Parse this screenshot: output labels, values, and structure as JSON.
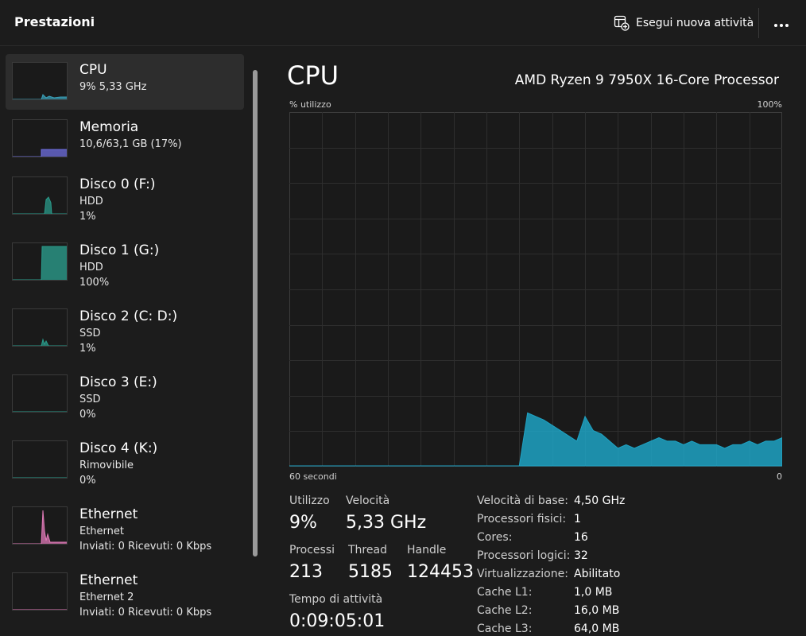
{
  "header": {
    "title": "Prestazioni",
    "run_task_label": "Esegui nuova attività",
    "more_icon": "ellipsis-icon"
  },
  "sidebar": {
    "items": [
      {
        "name": "CPU",
        "line1": "9%  5,33 GHz",
        "line2": "",
        "color": "#3aa0b8",
        "selected": true
      },
      {
        "name": "Memoria",
        "line1": "10,6/63,1 GB (17%)",
        "line2": "",
        "color": "#6f6fe0"
      },
      {
        "name": "Disco 0 (F:)",
        "line1": "HDD",
        "line2": "1%",
        "color": "#2a9a8a"
      },
      {
        "name": "Disco 1 (G:)",
        "line1": "HDD",
        "line2": "100%",
        "color": "#2a9a8a"
      },
      {
        "name": "Disco 2 (C: D:)",
        "line1": "SSD",
        "line2": "1%",
        "color": "#2a9a8a"
      },
      {
        "name": "Disco 3 (E:)",
        "line1": "SSD",
        "line2": "0%",
        "color": "#2a9a8a"
      },
      {
        "name": "Disco 4 (K:)",
        "line1": "Rimovibile",
        "line2": "0%",
        "color": "#2a9a8a"
      },
      {
        "name": "Ethernet",
        "line1": "Ethernet",
        "line2": "Inviati: 0 Ricevuti: 0 Kbps",
        "color": "#e07ab8"
      },
      {
        "name": "Ethernet",
        "line1": "Ethernet 2",
        "line2": "Inviati: 0 Ricevuti: 0 Kbps",
        "color": "#e07ab8"
      }
    ]
  },
  "main": {
    "title": "CPU",
    "processor": "AMD Ryzen 9 7950X 16-Core Processor",
    "graph": {
      "ylabel": "% utilizzo",
      "ymax_label": "100%",
      "xlabel_left": "60 secondi",
      "xlabel_right": "0",
      "color": "#1ea3c4"
    },
    "stats": {
      "utilizzo_label": "Utilizzo",
      "utilizzo": "9%",
      "velocita_label": "Velocità",
      "velocita": "5,33 GHz",
      "processi_label": "Processi",
      "processi": "213",
      "thread_label": "Thread",
      "thread": "5185",
      "handle_label": "Handle",
      "handle": "124453",
      "uptime_label": "Tempo di attività",
      "uptime": "0:09:05:01"
    },
    "details": [
      {
        "label": "Velocità di base:",
        "value": "4,50 GHz"
      },
      {
        "label": "Processori fisici:",
        "value": "1"
      },
      {
        "label": "Cores:",
        "value": "16"
      },
      {
        "label": "Processori logici:",
        "value": "32"
      },
      {
        "label": "Virtualizzazione:",
        "value": "Abilitato"
      },
      {
        "label": "Cache L1:",
        "value": "1,0 MB"
      },
      {
        "label": "Cache L2:",
        "value": "16,0 MB"
      },
      {
        "label": "Cache L3:",
        "value": "64,0 MB"
      }
    ]
  },
  "chart_data": {
    "type": "area",
    "ylim": [
      0,
      100
    ],
    "x": [
      60,
      32,
      31,
      29,
      27,
      25,
      24,
      23,
      22,
      21,
      20,
      19,
      18,
      17,
      16,
      15,
      14,
      13,
      12,
      11,
      10,
      9,
      8,
      7,
      6,
      5,
      4,
      3,
      2,
      1,
      0
    ],
    "series": [
      {
        "values": [
          0,
          0,
          15,
          13,
          10,
          7,
          14,
          10,
          9,
          7,
          5,
          6,
          5,
          6,
          7,
          8,
          7,
          7,
          6,
          7,
          6,
          6,
          6,
          5,
          6,
          6,
          7,
          6,
          7,
          7,
          8
        ]
      }
    ]
  }
}
